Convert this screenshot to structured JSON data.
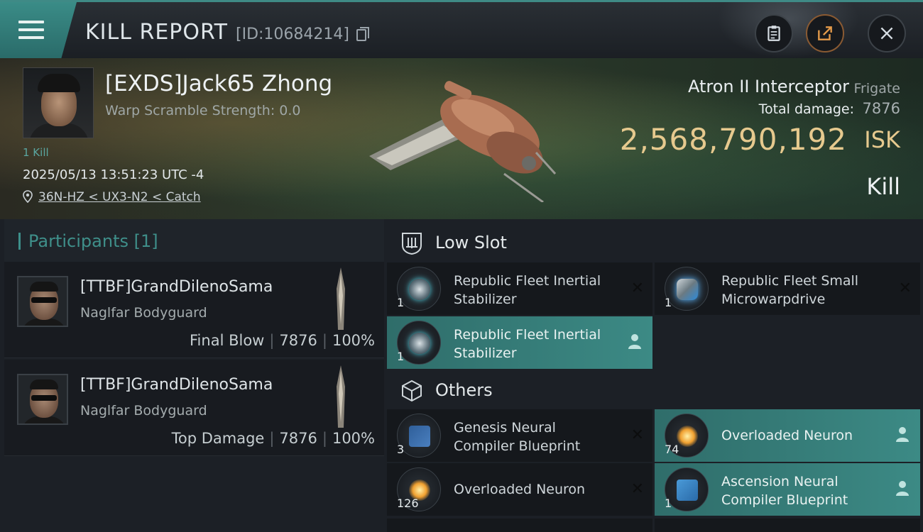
{
  "header": {
    "title": "KILL REPORT",
    "report_id": "[ID:10684214]",
    "icons": {
      "menu": "menu-icon",
      "copy": "copy-icon",
      "clipboard": "clipboard-icon",
      "share": "share-icon",
      "close": "close-icon"
    }
  },
  "victim": {
    "name": "[EXDS]Jack65 Zhong",
    "scram": "Warp Scramble Strength: 0.0",
    "kill_count": "1 Kill",
    "datetime": "2025/05/13 13:51:23 UTC -4",
    "location": "36N-HZ < UX3-N2 < Catch",
    "ship_name": "Atron II Interceptor",
    "ship_class": "Frigate",
    "total_damage_label": "Total damage:",
    "total_damage": "7876",
    "isk_value": "2,568,790,192",
    "isk_unit": "ISK",
    "result": "Kill"
  },
  "participants": {
    "header": "Participants [1]",
    "rows": [
      {
        "name": "[TTBF]GrandDilenoSama",
        "ship": "Naglfar Bodyguard",
        "role": "Final Blow",
        "damage": "7876",
        "percent": "100%"
      },
      {
        "name": "[TTBF]GrandDilenoSama",
        "ship": "Naglfar Bodyguard",
        "role": "Top Damage",
        "damage": "7876",
        "percent": "100%"
      }
    ]
  },
  "sections": {
    "low_slot": {
      "title": "Low Slot",
      "items": [
        {
          "name": "Republic Fleet Inertial Stabilizer",
          "qty": "1",
          "status": "destroyed"
        },
        {
          "name": "Republic Fleet Small Microwarpdrive",
          "qty": "1",
          "status": "destroyed"
        },
        {
          "name": "Republic Fleet Inertial Stabilizer",
          "qty": "1",
          "status": "dropped"
        }
      ]
    },
    "others": {
      "title": "Others",
      "items": [
        {
          "name": "Genesis Neural Compiler Blueprint",
          "qty": "3",
          "status": "destroyed"
        },
        {
          "name": "Overloaded Neuron",
          "qty": "74",
          "status": "dropped"
        },
        {
          "name": "Overloaded Neuron",
          "qty": "126",
          "status": "destroyed"
        },
        {
          "name": "Ascension Neural Compiler Blueprint",
          "qty": "1",
          "status": "dropped"
        }
      ]
    }
  },
  "colors": {
    "accent": "#3d8f8a",
    "isk": "#e6c98e",
    "dropped_bg": "#3c8a85"
  }
}
